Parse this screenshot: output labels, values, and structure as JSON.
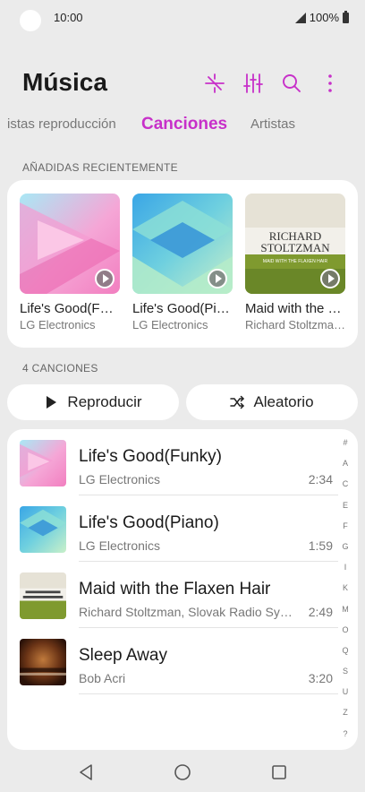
{
  "status": {
    "time": "10:00",
    "battery": "100%"
  },
  "header": {
    "title": "Música",
    "icons": [
      "equalizer-effect-icon",
      "mixer-icon",
      "search-icon",
      "more-icon"
    ]
  },
  "tabs": [
    {
      "label": "istas reproducción",
      "active": false
    },
    {
      "label": "Canciones",
      "active": true
    },
    {
      "label": "Artistas",
      "active": false
    }
  ],
  "recent": {
    "label": "AÑADIDAS RECIENTEMENTE",
    "items": [
      {
        "title": "Life's Good(Funky)",
        "artist": "LG Electronics",
        "cover": "pink"
      },
      {
        "title": "Life's Good(Piano)",
        "artist": "LG Electronics",
        "cover": "blue"
      },
      {
        "title": "Maid with the Flaxen Hair",
        "artist": "Richard Stoltzman, Slovak Radio Symphony",
        "cover": "stoltzman"
      }
    ],
    "album_cover_text": {
      "line1": "RICHARD",
      "line2": "STOLTZMAN",
      "line3": "MAID WITH THE FLAXEN HAIR"
    }
  },
  "songs": {
    "count_label": "4 CANCIONES",
    "play_label": "Reproducir",
    "shuffle_label": "Aleatorio",
    "items": [
      {
        "title": "Life's Good(Funky)",
        "artist": "LG Electronics",
        "duration": "2:34",
        "cover": "pink"
      },
      {
        "title": "Life's Good(Piano)",
        "artist": "LG Electronics",
        "duration": "1:59",
        "cover": "blue"
      },
      {
        "title": "Maid with the Flaxen Hair",
        "artist": "Richard Stoltzman, Slovak Radio Symphony",
        "duration": "2:49",
        "cover": "stoltzman"
      },
      {
        "title": "Sleep Away",
        "artist": "Bob Acri",
        "duration": "3:20",
        "cover": "piano"
      }
    ]
  },
  "index_letters": [
    "#",
    "A",
    "C",
    "E",
    "F",
    "G",
    "I",
    "K",
    "M",
    "O",
    "Q",
    "S",
    "U",
    "Z",
    "?"
  ],
  "colors": {
    "accent": "#c730c9",
    "background": "#ebebeb",
    "card": "#ffffff"
  }
}
